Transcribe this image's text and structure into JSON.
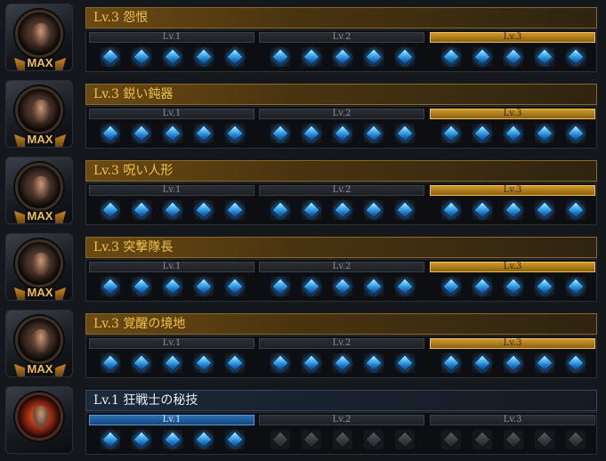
{
  "skills": [
    {
      "title": "Lv.3 怨恨",
      "max_label": "MAX",
      "level": 3,
      "tiers": [
        "Lv.1",
        "Lv.2",
        "Lv.3"
      ]
    },
    {
      "title": "Lv.3 鋭い鈍器",
      "max_label": "MAX",
      "level": 3,
      "tiers": [
        "Lv.1",
        "Lv.2",
        "Lv.3"
      ]
    },
    {
      "title": "Lv.3 呪い人形",
      "max_label": "MAX",
      "level": 3,
      "tiers": [
        "Lv.1",
        "Lv.2",
        "Lv.3"
      ]
    },
    {
      "title": "Lv.3 突撃隊長",
      "max_label": "MAX",
      "level": 3,
      "tiers": [
        "Lv.1",
        "Lv.2",
        "Lv.3"
      ]
    },
    {
      "title": "Lv.3 覚醒の境地",
      "max_label": "MAX",
      "level": 3,
      "tiers": [
        "Lv.1",
        "Lv.2",
        "Lv.3"
      ]
    },
    {
      "title": "Lv.1 狂戦士の秘技",
      "max_label": "",
      "level": 1,
      "tiers": [
        "Lv.1",
        "Lv.2",
        "Lv.3"
      ]
    }
  ],
  "gems_per_tier": 5,
  "colors": {
    "gold": "#f3c348",
    "gem_blue": "#4ab7f0",
    "active_blue": "#2a6fb3"
  }
}
